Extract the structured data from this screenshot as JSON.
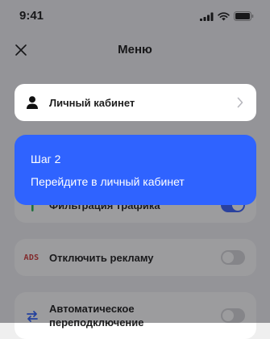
{
  "status_bar": {
    "time": "9:41"
  },
  "nav": {
    "title": "Меню"
  },
  "menu": {
    "account": "Личный кабинет",
    "traffic_filter": "Фильтрация трафика",
    "disable_ads": "Отключить рекламу",
    "auto_switch_line1": "Автоматическое",
    "auto_switch_line2": "переподключение",
    "ads_icon_text": "ADS"
  },
  "toggles": {
    "traffic_filter_on": true,
    "disable_ads_on": false,
    "auto_switch_on": false
  },
  "tooltip": {
    "step": "Шаг 2",
    "text": "Перейдите в личный кабинет"
  },
  "colors": {
    "accent": "#3b63ff",
    "tooltip": "#2f63ff",
    "ads_red": "#d23a3a",
    "switch_blue": "#2f63ff",
    "traffic_green": "#29b35a"
  }
}
